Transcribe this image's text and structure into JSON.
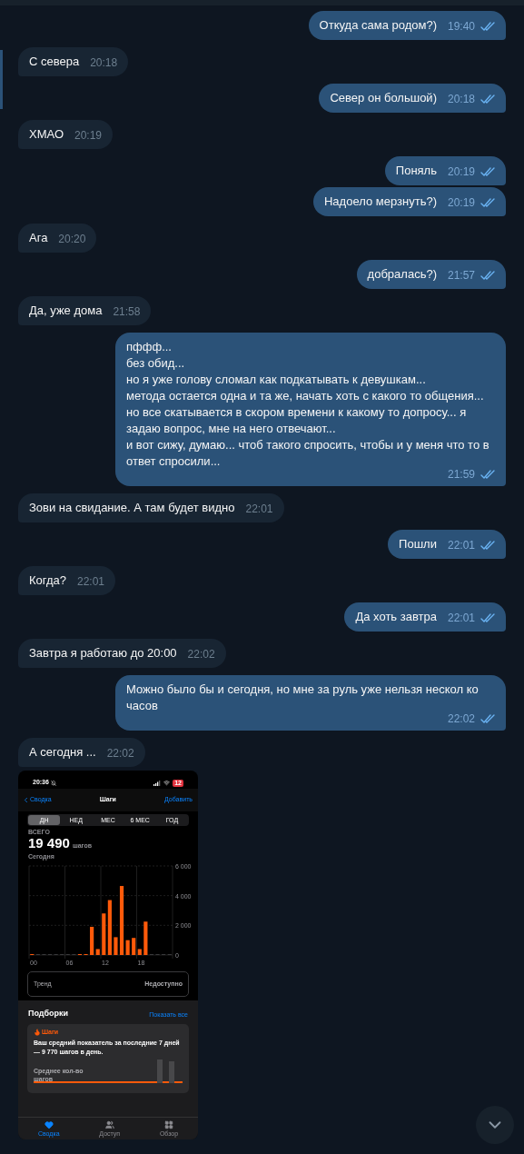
{
  "messages": [
    {
      "kind": "out",
      "text": "Откуда сама родом?)",
      "time": "19:40",
      "read": true
    },
    {
      "kind": "in",
      "text": "С севера",
      "time": "20:18"
    },
    {
      "kind": "out",
      "text": "Север он большой)",
      "time": "20:18",
      "read": true
    },
    {
      "kind": "in",
      "text": "ХМАО",
      "time": "20:19"
    },
    {
      "kind": "out",
      "text": "Поняль",
      "time": "20:19",
      "read": true
    },
    {
      "kind": "out",
      "text": "Надоело мерзнуть?)",
      "time": "20:19",
      "read": true
    },
    {
      "kind": "in",
      "text": "Ага",
      "time": "20:20"
    },
    {
      "kind": "out",
      "text": "добралась?)",
      "time": "21:57",
      "read": true
    },
    {
      "kind": "in",
      "text": "Да, уже дома",
      "time": "21:58"
    },
    {
      "kind": "out",
      "text": "пффф...\nбез обид...\nно я уже голову сломал как подкатывать к девушкам...\nметода остается одна и та же, начать хоть с какого то общения...\nно все скатывается в скором времени к какому то допросу... я задаю вопрос, мне на него отвечают...\nи вот сижу, думаю... чтоб такого спросить, чтобы и у меня что то в ответ спросили...",
      "time": "21:59",
      "read": true
    },
    {
      "kind": "in",
      "text": "Зови на свидание. А там будет видно",
      "time": "22:01"
    },
    {
      "kind": "out",
      "text": "Пошли",
      "time": "22:01",
      "read": true
    },
    {
      "kind": "in",
      "text": "Когда?",
      "time": "22:01"
    },
    {
      "kind": "out",
      "text": "Да хоть завтра",
      "time": "22:01",
      "read": true
    },
    {
      "kind": "in",
      "text": "Завтра я работаю до 20:00",
      "time": "22:02"
    },
    {
      "kind": "out",
      "text": "Можно было бы и сегодня, но мне за руль уже нельзя нескол ко часов",
      "time": "22:02",
      "read": true
    },
    {
      "kind": "in",
      "text": "А сегодня ...",
      "time": "22:02"
    }
  ],
  "screenshot": {
    "status_bar": {
      "time": "20:36",
      "battery": "12"
    },
    "nav": {
      "back": "Сводка",
      "title": "Шаги",
      "action": "Добавить"
    },
    "segments": [
      {
        "label": "ДН",
        "selected": true
      },
      {
        "label": "НЕД",
        "selected": false
      },
      {
        "label": "МЕС",
        "selected": false
      },
      {
        "label": "6 МЕС",
        "selected": false
      },
      {
        "label": "ГОД",
        "selected": false
      }
    ],
    "total_label": "ВСЕГО",
    "total": "19 490",
    "unit": "шагов",
    "period": "Сегодня",
    "chart_data": {
      "type": "bar",
      "x": [
        0,
        1,
        2,
        3,
        4,
        5,
        6,
        7,
        8,
        9,
        10,
        11,
        12,
        13,
        14,
        15,
        16,
        17,
        18,
        19,
        20,
        21,
        22,
        23
      ],
      "values": [
        30,
        0,
        0,
        0,
        0,
        0,
        0,
        0,
        40,
        40,
        1900,
        400,
        2800,
        3700,
        1200,
        4650,
        1000,
        1150,
        400,
        2250,
        0,
        0,
        0,
        0
      ],
      "xlim": [
        -0.5,
        23.5
      ],
      "ylim": [
        0,
        6000
      ],
      "yticks": [
        {
          "value": 0,
          "label": "0"
        },
        {
          "value": 2000,
          "label": "2 000"
        },
        {
          "value": 4000,
          "label": "4 000"
        },
        {
          "value": 6000,
          "label": "6 000"
        }
      ],
      "xticks": [
        {
          "value": 0,
          "label": "00"
        },
        {
          "value": 6,
          "label": "06"
        },
        {
          "value": 12,
          "label": "12"
        },
        {
          "value": 18,
          "label": "18"
        }
      ]
    },
    "trend": {
      "label": "Тренд",
      "value": "Недоступно"
    },
    "highlights": {
      "title": "Подборки",
      "link": "Показать все",
      "card_title": "Шаги",
      "card_text": "Ваш средний показатель за последние 7 дней — 9 770 шагов в день.",
      "card_label": "Среднее кол-во шагов"
    },
    "tabs": [
      {
        "label": "Сводка",
        "selected": true
      },
      {
        "label": "Доступ",
        "selected": false
      },
      {
        "label": "Обзор",
        "selected": false
      }
    ]
  }
}
